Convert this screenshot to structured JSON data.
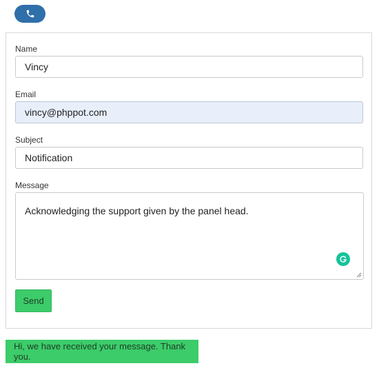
{
  "header": {
    "phone_icon": "phone-icon",
    "accent_color": "#2f6faa"
  },
  "form": {
    "name": {
      "label": "Name",
      "value": "Vincy"
    },
    "email": {
      "label": "Email",
      "value": "vincy@phppot.com"
    },
    "subject": {
      "label": "Subject",
      "value": "Notification"
    },
    "message": {
      "label": "Message",
      "value": "Acknowledging the support given by the panel head."
    },
    "send_label": "Send",
    "send_color": "#3ccc6a"
  },
  "status": {
    "success_text": "Hi, we have received your message. Thank you."
  }
}
